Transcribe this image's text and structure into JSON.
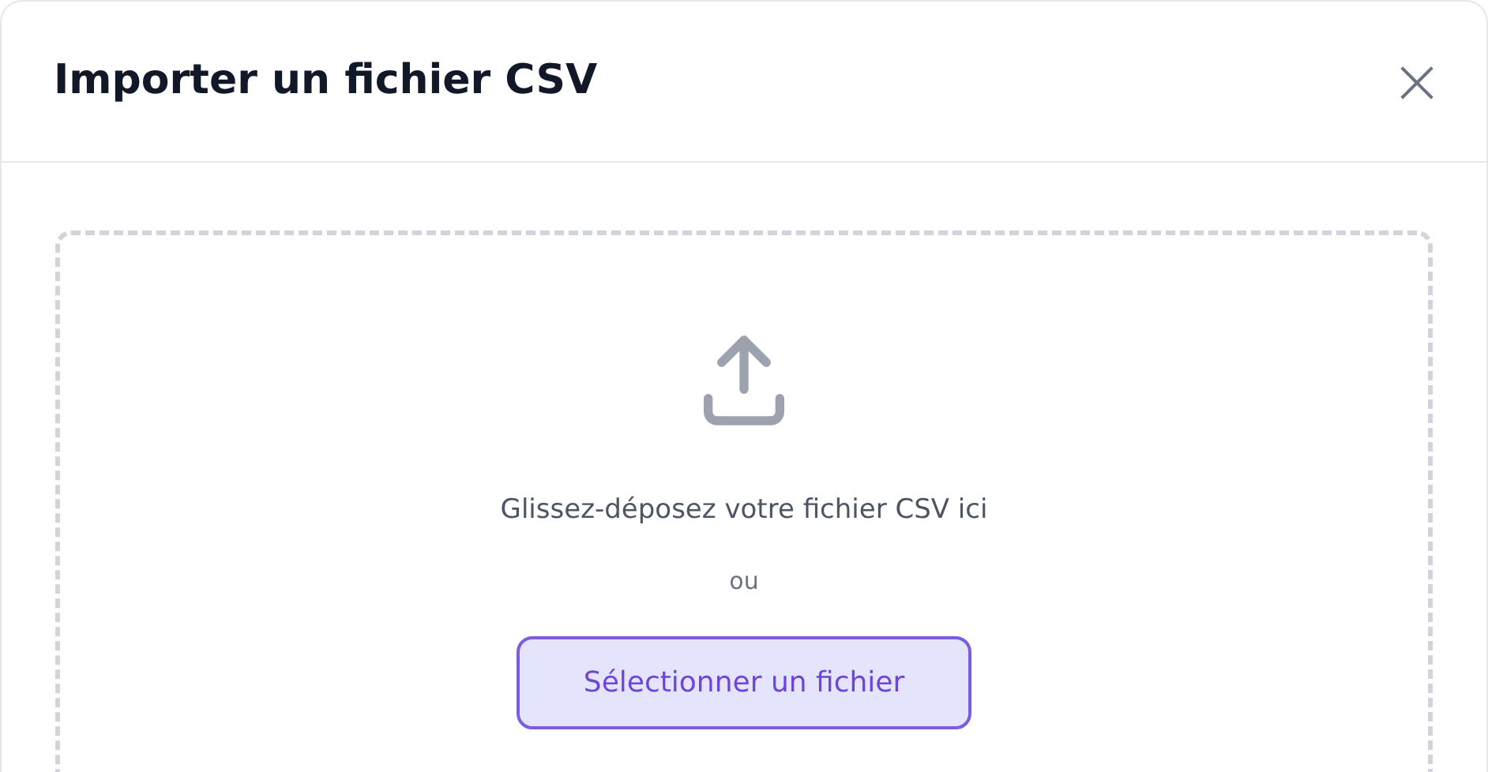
{
  "dialog": {
    "title": "Importer un fichier CSV",
    "close_label": "×"
  },
  "dropzone": {
    "instruction": "Glissez-déposez votre fichier CSV ici",
    "separator": "ou",
    "button": "Sélectionner un fichier"
  }
}
